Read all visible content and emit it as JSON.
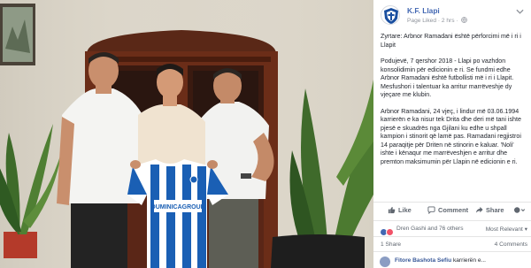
{
  "post": {
    "page_name": "K.F. Llapi",
    "meta": "Page Liked · 2 hrs ·",
    "paragraph_1": "Zyrtare: Arbnor Ramadani është përforcimi më i ri i Llapit",
    "paragraph_2": "Podujevë, 7 qershor 2018 - Llapi po vazhdon konsolidimin për edicionin e ri. Se fundmi edhe Arbnor Ramadani është futbollisti më i ri i Llapit. Mesfushori i talentuar ka arritur marrëveshje dy vjeçare me klubin.",
    "paragraph_3": "Arbnor Ramadani, 24 vjeç, i lindur më 03.06.1994 karrierën e ka nisur tek Drita dhe deri më tani ishte pjesë e skuadrës nga Gjilani ku edhe u shpall kampion i stinorit që lamë pas. Ramadani regjistroi 14 paraqitje për Driten në stinorin e kaluar. 'Noli' ishte i kënaqur me marrëveshjen e arritur dhe premton maksimumin për Llapin në edicionin e ri."
  },
  "actions": {
    "like": "Like",
    "comment": "Comment",
    "share": "Share"
  },
  "reactions": {
    "summary": "Dren Gashi and 76 others",
    "sort": "Most Relevant",
    "shares": "1 Share",
    "comments": "4 Comments"
  },
  "comment_preview": {
    "author": "Fitore Bashota Sefiu",
    "text": "karrierën e..."
  },
  "jersey": {
    "sponsor": "DUMINICAGROUP"
  },
  "colors": {
    "brand_blue": "#4267b2",
    "link_blue": "#385898",
    "text": "#1d2129",
    "muted": "#90949c",
    "jersey_blue": "#1a5fb4"
  }
}
